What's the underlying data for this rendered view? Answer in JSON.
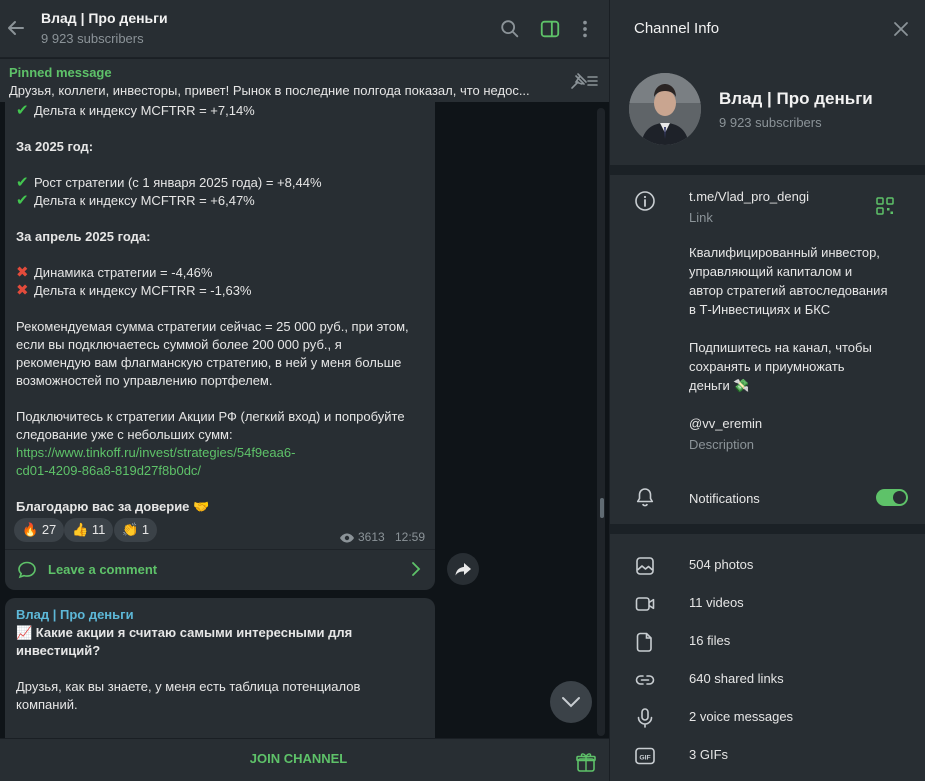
{
  "chat": {
    "title": "Влад | Про деньги",
    "subtitle": "9 923 subscribers",
    "pinned_title": "Pinned message",
    "pinned_text": "Друзья, коллеги, инвесторы, привет!  Рынок в последние полгода показал, что недос..."
  },
  "message1": {
    "lines": [
      "Дельта к индексу MCFTRR = +7,14%",
      "За 2025 год:",
      "Рост стратегии (с 1 января 2025 года) = +8,44%",
      "Дельта к индексу MCFTRR = +6,47%",
      "За апрель 2025 года:",
      "Динамика стратегии = -4,46%",
      "Дельта к индексу MCFTRR = -1,63%",
      "Рекомендуемая сумма стратегии сейчас = 25 000 руб., при этом,",
      "если вы подключаетесь суммой более 200 000 руб., я",
      "рекомендую вам флагманскую стратегию, в ней у меня больше",
      "возможностей по управлению портфелем.",
      "Подключитесь к стратегии Акции РФ (легкий вход) и попробуйте",
      "следование уже с небольших сумм:",
      "https://www.tinkoff.ru/invest/strategies/54f9eaa6-",
      "cd01-4209-86a8-819d27f8b0dc/",
      "Благодарю вас за доверие 🤝"
    ],
    "reactions": [
      {
        "emoji": "🔥",
        "count": "27"
      },
      {
        "emoji": "👍",
        "count": "11"
      },
      {
        "emoji": "👏",
        "count": "1"
      }
    ],
    "views": "3613",
    "time": "12:59",
    "comment_label": "Leave a comment"
  },
  "message2": {
    "author": "Влад | Про деньги",
    "title_line1": "📈 Какие акции я считаю самыми интересными для",
    "title_line2": "инвестиций?",
    "body_line1": "Друзья, как вы знаете, у меня есть таблица потенциалов",
    "body_line2": "компаний."
  },
  "footer": {
    "join_label": "JOIN CHANNEL"
  },
  "info": {
    "header": "Channel Info",
    "name": "Влад | Про деньги",
    "subscribers": "9 923 subscribers",
    "link": "t.me/Vlad_pro_dengi",
    "link_caption": "Link",
    "desc_lines": [
      "Квалифицированный инвестор,",
      "управляющий капиталом и",
      "автор стратегий автоследования",
      "в Т-Инвестициях и БКС",
      "Подпишитесь на канал, чтобы",
      "сохранять и приумножать",
      "деньги 💸"
    ],
    "username": "@vv_eremin",
    "desc_caption": "Description",
    "notifications_label": "Notifications",
    "notifications_on": true,
    "media": [
      {
        "icon": "photo-icon",
        "label": "504 photos"
      },
      {
        "icon": "video-icon",
        "label": "11 videos"
      },
      {
        "icon": "file-icon",
        "label": "16 files"
      },
      {
        "icon": "link-icon",
        "label": "640 shared links"
      },
      {
        "icon": "mic-icon",
        "label": "2 voice messages"
      },
      {
        "icon": "gif-icon",
        "label": "3 GIFs"
      }
    ]
  },
  "colors": {
    "accent": "#5ec269",
    "panel": "#282e33",
    "background": "#0f1418",
    "muted": "#8b9398"
  }
}
